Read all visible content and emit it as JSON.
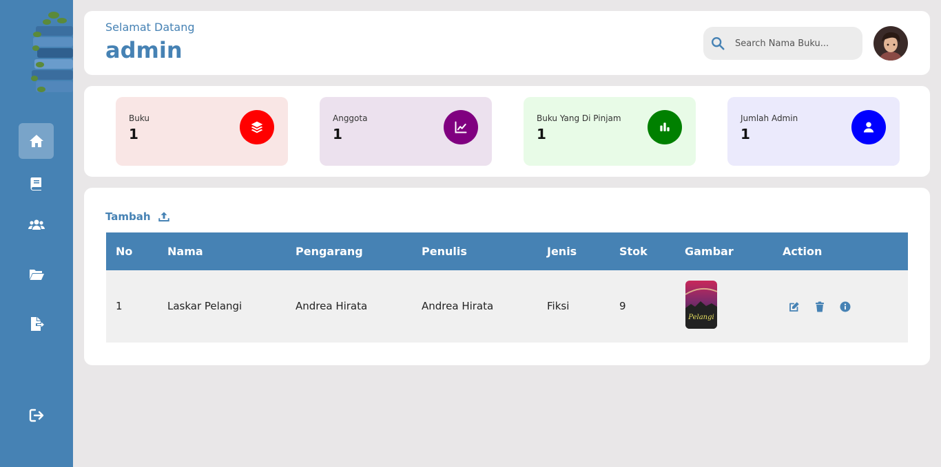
{
  "sidebar": {
    "logo_icon": "book-stack-logo",
    "items": [
      {
        "icon": "home-icon",
        "active": true
      },
      {
        "icon": "book-icon",
        "active": false
      },
      {
        "icon": "users-icon",
        "active": false
      },
      {
        "icon": "folder-open-icon",
        "active": false
      },
      {
        "icon": "file-export-icon",
        "active": false
      }
    ],
    "logout_icon": "logout-icon"
  },
  "header": {
    "welcome": "Selamat Datang",
    "username": "admin",
    "search_placeholder": "Search Nama Buku..."
  },
  "stats": [
    {
      "label": "Buku",
      "value": "1",
      "icon": "layers-icon",
      "color": "#ff0000",
      "bg": "#f9e6e5"
    },
    {
      "label": "Anggota",
      "value": "1",
      "icon": "chart-line-icon",
      "color": "#800080",
      "bg": "#ece1ee"
    },
    {
      "label": "Buku Yang Di Pinjam",
      "value": "1",
      "icon": "chart-bar-icon",
      "color": "#008000",
      "bg": "#e8fbe7"
    },
    {
      "label": "Jumlah Admin",
      "value": "1",
      "icon": "user-icon",
      "color": "#0000ff",
      "bg": "#ebeafc"
    }
  ],
  "table": {
    "add_label": "Tambah",
    "columns": [
      "No",
      "Nama",
      "Pengarang",
      "Penulis",
      "Jenis",
      "Stok",
      "Gambar",
      "Action"
    ],
    "rows": [
      {
        "no": "1",
        "nama": "Laskar Pelangi",
        "pengarang": "Andrea Hirata",
        "penulis": "Andrea Hirata",
        "jenis": "Fiksi",
        "stok": "9",
        "cover_text": "Pelangi"
      }
    ]
  },
  "colors": {
    "primary": "#4682b4"
  }
}
